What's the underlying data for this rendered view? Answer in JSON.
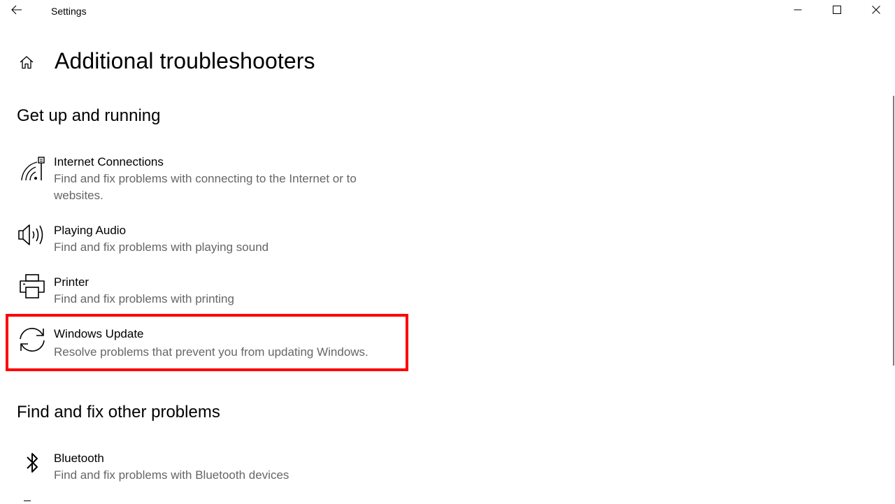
{
  "window": {
    "app_title": "Settings",
    "controls": {
      "back": "back-arrow-icon",
      "minimize": "minimize-icon",
      "maximize": "maximize-icon",
      "close": "close-icon"
    }
  },
  "page": {
    "title": "Additional troubleshooters",
    "home_icon": "home-icon"
  },
  "sections": [
    {
      "title": "Get up and running",
      "items": [
        {
          "icon": "internet-connection-icon",
          "title": "Internet Connections",
          "description": "Find and fix problems with connecting to the Internet or to websites."
        },
        {
          "icon": "speaker-icon",
          "title": "Playing Audio",
          "description": "Find and fix problems with playing sound"
        },
        {
          "icon": "printer-icon",
          "title": "Printer",
          "description": "Find and fix problems with printing"
        },
        {
          "icon": "sync-icon",
          "title": "Windows Update",
          "description": "Resolve problems that prevent you from updating Windows.",
          "highlighted": true
        }
      ]
    },
    {
      "title": "Find and fix other problems",
      "items": [
        {
          "icon": "bluetooth-icon",
          "title": "Bluetooth",
          "description": "Find and fix problems with Bluetooth devices"
        }
      ]
    }
  ],
  "colors": {
    "highlight_border": "#ff0000",
    "secondary_text": "#666666",
    "text": "#000000",
    "background": "#ffffff"
  }
}
